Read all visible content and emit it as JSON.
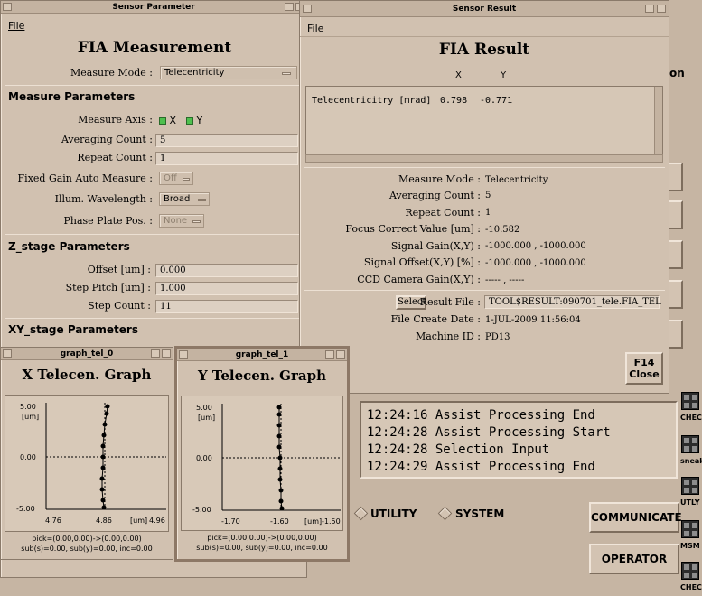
{
  "sensor_parameter": {
    "window_title": "Sensor Parameter",
    "menu_file": "File",
    "title": "FIA Measurement",
    "measure_mode_label": "Measure Mode :",
    "measure_mode_value": "Telecentricity",
    "section_measure": "Measure Parameters",
    "measure_axis_label": "Measure Axis :",
    "axis_x": "X",
    "axis_y": "Y",
    "averaging_count_label": "Averaging Count :",
    "averaging_count_value": "5",
    "repeat_count_label": "Repeat Count :",
    "repeat_count_value": "1",
    "fixed_gain_label": "Fixed Gain Auto Measure :",
    "fixed_gain_value": "Off",
    "illum_label": "Illum. Wavelength :",
    "illum_value": "Broad",
    "phase_plate_label": "Phase Plate Pos. :",
    "phase_plate_value": "None",
    "section_z": "Z_stage Parameters",
    "offset_label": "Offset [um] :",
    "offset_value": "0.000",
    "step_pitch_label": "Step Pitch [um] :",
    "step_pitch_value": "1.000",
    "step_count_label": "Step Count :",
    "step_count_value": "11",
    "section_xy": "XY_stage Parameters"
  },
  "sensor_result": {
    "window_title": "Sensor Result",
    "menu_file": "File",
    "title": "FIA Result",
    "col_x": "X",
    "col_y": "Y",
    "row_label": "Telecentricitry [mrad]",
    "row_x": "0.798",
    "row_y": "-0.771",
    "measure_mode_label": "Measure Mode :",
    "measure_mode_value": "Telecentricity",
    "averaging_label": "Averaging Count :",
    "averaging_value": "5",
    "repeat_label": "Repeat Count :",
    "repeat_value": "1",
    "focus_label": "Focus Correct Value [um] :",
    "focus_value": "-10.582",
    "signal_gain_label": "Signal Gain(X,Y) :",
    "signal_gain_value": "-1000.000 , -1000.000",
    "signal_offset_label": "Signal Offset(X,Y) [%] :",
    "signal_offset_value": "-1000.000 , -1000.000",
    "ccd_label": "CCD Camera Gain(X,Y) :",
    "ccd_value": "----- , -----",
    "select_button": "Select",
    "result_file_label": "Result File :",
    "result_file_value": "TOOL$RESULT:090701_tele.FIA_TEL",
    "file_date_label": "File Create Date :",
    "file_date_value": "1-JUL-2009 11:56:04",
    "machine_label": "Machine ID :",
    "machine_value": "PD13",
    "f14_key": "F14",
    "close_label": "Close"
  },
  "graph0": {
    "window_title": "graph_tel_0",
    "title": "X Telecen. Graph",
    "y_top": "5.00",
    "y_unit": "[um]",
    "y_mid": "0.00",
    "y_bottom": "-5.00",
    "x_left": "4.76",
    "x_mid": "4.86",
    "x_unit": "[um]",
    "x_right": "4.96",
    "pick": "pick=(0.00,0.00)->(0.00,0.00)",
    "sub": "sub(s)=0.00, sub(y)=0.00, inc=0.00"
  },
  "graph1": {
    "window_title": "graph_tel_1",
    "title": "Y Telecen. Graph",
    "y_top": "5.00",
    "y_unit": "[um]",
    "y_mid": "0.00",
    "y_bottom": "-5.00",
    "x_left": "-1.70",
    "x_mid": "-1.60",
    "x_unit": "[um]",
    "x_right": "-1.50",
    "pick": "pick=(0.00,0.00)->(0.00,0.00)",
    "sub": "sub(s)=0.00, sub(y)=0.00, inc=0.00"
  },
  "log": [
    "12:24:16 Assist Processing End",
    "12:24:28 Assist Processing Start",
    "12:24:28 Selection Input",
    "12:24:29 Assist Processing End"
  ],
  "bottom": {
    "utility": "UTILITY",
    "system": "SYSTEM",
    "communicate": "COMMUNICATE",
    "operator": "OPERATOR",
    "behind_text": "on"
  },
  "side_labels": [
    "CHECI",
    "sneak",
    "UTLY",
    "MSM",
    "CHECI"
  ]
}
